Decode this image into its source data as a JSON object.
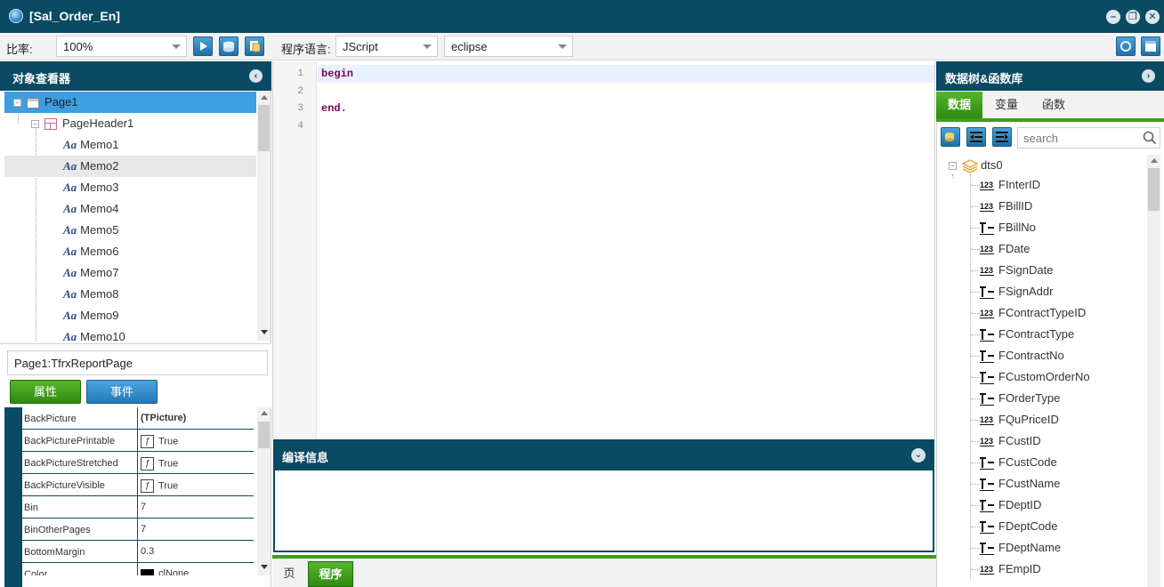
{
  "window": {
    "title": "[Sal_Order_En]"
  },
  "toolbar": {
    "zoom_label": "比率:",
    "zoom_value": "100%",
    "lang_label": "程序语言:",
    "lang_value": "JScript",
    "theme_value": "eclipse"
  },
  "left": {
    "header": "对象查看器",
    "tree": [
      {
        "label": "Page1",
        "kind": "page"
      },
      {
        "label": "PageHeader1",
        "kind": "header"
      },
      {
        "label": "Memo1",
        "kind": "memo"
      },
      {
        "label": "Memo2",
        "kind": "memo"
      },
      {
        "label": "Memo3",
        "kind": "memo"
      },
      {
        "label": "Memo4",
        "kind": "memo"
      },
      {
        "label": "Memo5",
        "kind": "memo"
      },
      {
        "label": "Memo6",
        "kind": "memo"
      },
      {
        "label": "Memo7",
        "kind": "memo"
      },
      {
        "label": "Memo8",
        "kind": "memo"
      },
      {
        "label": "Memo9",
        "kind": "memo"
      },
      {
        "label": "Memo10",
        "kind": "memo"
      }
    ],
    "object_field": "Page1:TfrxReportPage",
    "tab_props": "属性",
    "tab_events": "事件",
    "props": [
      {
        "name": "BackPicture",
        "value": "(TPicture)",
        "bold": true
      },
      {
        "name": "BackPicturePrintable",
        "value": "True",
        "check": true
      },
      {
        "name": "BackPictureStretched",
        "value": "True",
        "check": true
      },
      {
        "name": "BackPictureVisible",
        "value": "True",
        "check": true
      },
      {
        "name": "Bin",
        "value": "7"
      },
      {
        "name": "BinOtherPages",
        "value": "7"
      },
      {
        "name": "BottomMargin",
        "value": "0.3"
      },
      {
        "name": "Color",
        "value": "clNone",
        "swatch": true
      }
    ]
  },
  "editor": {
    "lines": [
      "begin",
      "",
      "end.",
      ""
    ],
    "line_numbers": [
      "1",
      "2",
      "3",
      "4"
    ],
    "compile_header": "编译信息"
  },
  "bottom_tabs": {
    "page": "页",
    "code": "程序"
  },
  "right": {
    "header": "数据树&函数库",
    "tabs": [
      "数据",
      "变量",
      "函数"
    ],
    "search_placeholder": "search",
    "dataset": "dts0",
    "fields": [
      {
        "name": "FInterID",
        "type": "num"
      },
      {
        "name": "FBillID",
        "type": "num"
      },
      {
        "name": "FBillNo",
        "type": "text"
      },
      {
        "name": "FDate",
        "type": "num"
      },
      {
        "name": "FSignDate",
        "type": "num"
      },
      {
        "name": "FSignAddr",
        "type": "text"
      },
      {
        "name": "FContractTypeID",
        "type": "num"
      },
      {
        "name": "FContractType",
        "type": "text"
      },
      {
        "name": "FContractNo",
        "type": "text"
      },
      {
        "name": "FCustomOrderNo",
        "type": "text"
      },
      {
        "name": "FOrderType",
        "type": "text"
      },
      {
        "name": "FQuPriceID",
        "type": "num"
      },
      {
        "name": "FCustID",
        "type": "num"
      },
      {
        "name": "FCustCode",
        "type": "text"
      },
      {
        "name": "FCustName",
        "type": "text"
      },
      {
        "name": "FDeptID",
        "type": "text"
      },
      {
        "name": "FDeptCode",
        "type": "text"
      },
      {
        "name": "FDeptName",
        "type": "text"
      },
      {
        "name": "FEmpID",
        "type": "num"
      }
    ]
  },
  "colors": {
    "header_bg": "#0a4a63",
    "green_tab": "#3f9e1a",
    "blue_btn": "#2d86c8",
    "selection": "#3d9ee0"
  }
}
